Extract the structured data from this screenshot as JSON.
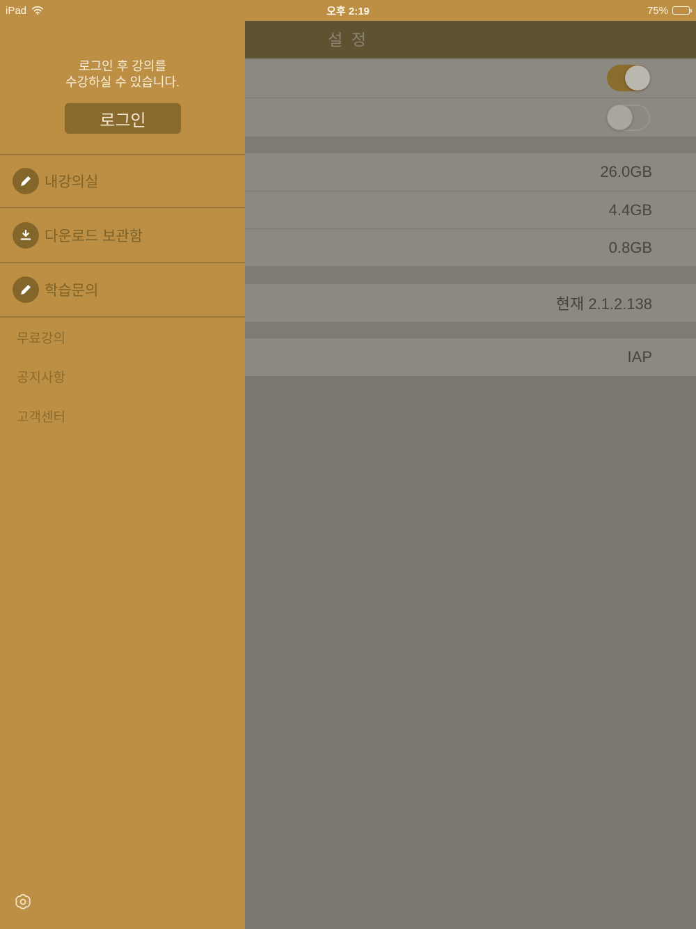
{
  "status_bar": {
    "device": "iPad",
    "time": "오후 2:19",
    "battery_percent": "75%",
    "battery_level": 75
  },
  "sidebar": {
    "login_message_line1": "로그인 후 강의를",
    "login_message_line2": "수강하실 수 있습니다.",
    "login_button_label": "로그인",
    "menu_items": [
      {
        "label": "내강의실",
        "icon": "pencil-icon"
      },
      {
        "label": "다운로드 보관함",
        "icon": "download-icon"
      },
      {
        "label": "학습문의",
        "icon": "pencil-icon"
      }
    ],
    "secondary_items": [
      {
        "label": "무료강의"
      },
      {
        "label": "공지사항"
      },
      {
        "label": "고객센터"
      }
    ],
    "gear_icon": "gear-icon"
  },
  "settings": {
    "title": "설 정",
    "toggle_rows": [
      {
        "state": "on"
      },
      {
        "state": "off"
      }
    ],
    "storage_rows": [
      {
        "value": "26.0GB"
      },
      {
        "value": "4.4GB"
      },
      {
        "value": "0.8GB"
      }
    ],
    "version_row": {
      "value": "현재 2.1.2.138"
    },
    "purchase_row": {
      "value": "IAP"
    }
  },
  "colors": {
    "accent_gold": "#bd8f45",
    "button_brown": "#8a692c",
    "toggle_on": "#8a6c2c",
    "dim_row_bg": "#8c8981",
    "dim_navbar_bg": "#5f5230"
  }
}
